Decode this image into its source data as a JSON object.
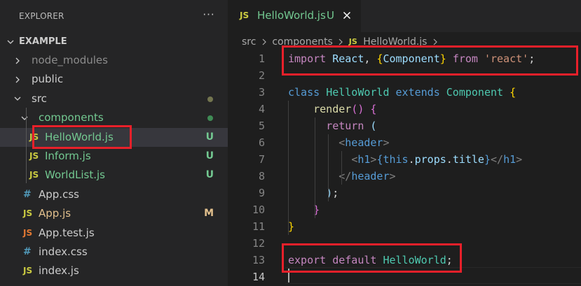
{
  "explorer": {
    "title": "EXPLORER",
    "more_icon": "ellipsis-icon",
    "project": "EXAMPLE",
    "items": [
      {
        "label": "node_modules",
        "type": "folder",
        "expanded": false,
        "color": "#8c8c8c"
      },
      {
        "label": "public",
        "type": "folder",
        "expanded": false,
        "color": "#cccccc"
      },
      {
        "label": "src",
        "type": "folder",
        "expanded": true,
        "color": "#cccccc",
        "status_dot": "#73754f"
      },
      {
        "label": "components",
        "type": "folder",
        "expanded": true,
        "color": "#73c991",
        "status_dot": "#3f8b55"
      },
      {
        "label": "HelloWorld.js",
        "type": "file",
        "icon": "JS",
        "icon_color": "#cbcb41",
        "color": "#73c991",
        "badge": "U",
        "badge_color": "#73c991",
        "selected": true
      },
      {
        "label": "Inform.js",
        "type": "file",
        "icon": "JS",
        "icon_color": "#cbcb41",
        "color": "#73c991",
        "badge": "U",
        "badge_color": "#73c991"
      },
      {
        "label": "WorldList.js",
        "type": "file",
        "icon": "JS",
        "icon_color": "#cbcb41",
        "color": "#73c991",
        "badge": "U",
        "badge_color": "#73c991"
      },
      {
        "label": "App.css",
        "type": "file",
        "icon": "#",
        "icon_color": "#519aba",
        "color": "#cccccc"
      },
      {
        "label": "App.js",
        "type": "file",
        "icon": "JS",
        "icon_color": "#cbcb41",
        "color": "#e2c08d",
        "badge": "M",
        "badge_color": "#e2c08d"
      },
      {
        "label": "App.test.js",
        "type": "file",
        "icon": "JS",
        "icon_color": "#e37933",
        "color": "#cccccc"
      },
      {
        "label": "index.css",
        "type": "file",
        "icon": "#",
        "icon_color": "#519aba",
        "color": "#cccccc"
      },
      {
        "label": "index.js",
        "type": "file",
        "icon": "JS",
        "icon_color": "#cbcb41",
        "color": "#cccccc"
      }
    ]
  },
  "tab": {
    "icon": "JS",
    "label": "HelloWorld.js",
    "badge": "U",
    "close_icon": "close-icon"
  },
  "breadcrumb": {
    "parts": [
      "src",
      "components",
      "HelloWorld.js"
    ],
    "file_icon": "JS"
  },
  "editor": {
    "lines": [
      {
        "n": "1",
        "tokens": [
          [
            "import",
            "kw"
          ],
          [
            " ",
            "plain"
          ],
          [
            "React",
            "var"
          ],
          [
            ", ",
            "plain"
          ],
          [
            "{",
            "brace2"
          ],
          [
            "Component",
            "var"
          ],
          [
            "}",
            "brace2"
          ],
          [
            " ",
            "plain"
          ],
          [
            "from",
            "kw"
          ],
          [
            " ",
            "plain"
          ],
          [
            "'react'",
            "str"
          ],
          [
            ";",
            "plain"
          ]
        ]
      },
      {
        "n": "2",
        "tokens": []
      },
      {
        "n": "3",
        "tokens": [
          [
            "class",
            "blue"
          ],
          [
            " ",
            "plain"
          ],
          [
            "HelloWorld",
            "type"
          ],
          [
            " ",
            "plain"
          ],
          [
            "extends",
            "blue"
          ],
          [
            " ",
            "plain"
          ],
          [
            "Component",
            "type"
          ],
          [
            " ",
            "plain"
          ],
          [
            "{",
            "brace2"
          ]
        ]
      },
      {
        "n": "4",
        "tokens": [
          [
            "    ",
            "plain"
          ],
          [
            "render",
            "fn"
          ],
          [
            "()",
            "brace"
          ],
          [
            " ",
            "plain"
          ],
          [
            "{",
            "brace"
          ]
        ]
      },
      {
        "n": "5",
        "tokens": [
          [
            "      ",
            "plain"
          ],
          [
            "return",
            "kw"
          ],
          [
            " ",
            "plain"
          ],
          [
            "(",
            "var"
          ]
        ]
      },
      {
        "n": "6",
        "tokens": [
          [
            "        ",
            "plain"
          ],
          [
            "<",
            "punc"
          ],
          [
            "header",
            "tag"
          ],
          [
            ">",
            "punc"
          ]
        ]
      },
      {
        "n": "7",
        "tokens": [
          [
            "          ",
            "plain"
          ],
          [
            "<",
            "punc"
          ],
          [
            "h1",
            "tag"
          ],
          [
            ">",
            "punc"
          ],
          [
            "{",
            "blue"
          ],
          [
            "this",
            "blue"
          ],
          [
            ".",
            "plain"
          ],
          [
            "props",
            "var"
          ],
          [
            ".",
            "plain"
          ],
          [
            "title",
            "var"
          ],
          [
            "}",
            "blue"
          ],
          [
            "</",
            "punc"
          ],
          [
            "h1",
            "tag"
          ],
          [
            ">",
            "punc"
          ]
        ]
      },
      {
        "n": "8",
        "tokens": [
          [
            "        ",
            "plain"
          ],
          [
            "</",
            "punc"
          ],
          [
            "header",
            "tag"
          ],
          [
            ">",
            "punc"
          ]
        ]
      },
      {
        "n": "9",
        "tokens": [
          [
            "      ",
            "plain"
          ],
          [
            ")",
            "var"
          ],
          [
            ";",
            "plain"
          ]
        ]
      },
      {
        "n": "10",
        "tokens": [
          [
            "    ",
            "plain"
          ],
          [
            "}",
            "brace"
          ]
        ]
      },
      {
        "n": "11",
        "tokens": [
          [
            "}",
            "brace2"
          ]
        ]
      },
      {
        "n": "12",
        "tokens": []
      },
      {
        "n": "13",
        "tokens": [
          [
            "export",
            "kw"
          ],
          [
            " ",
            "plain"
          ],
          [
            "default",
            "kw"
          ],
          [
            " ",
            "plain"
          ],
          [
            "HelloWorld",
            "type"
          ],
          [
            ";",
            "plain"
          ]
        ]
      },
      {
        "n": "14",
        "tokens": [],
        "active": true
      }
    ]
  },
  "highlight_color": "#e8202a"
}
